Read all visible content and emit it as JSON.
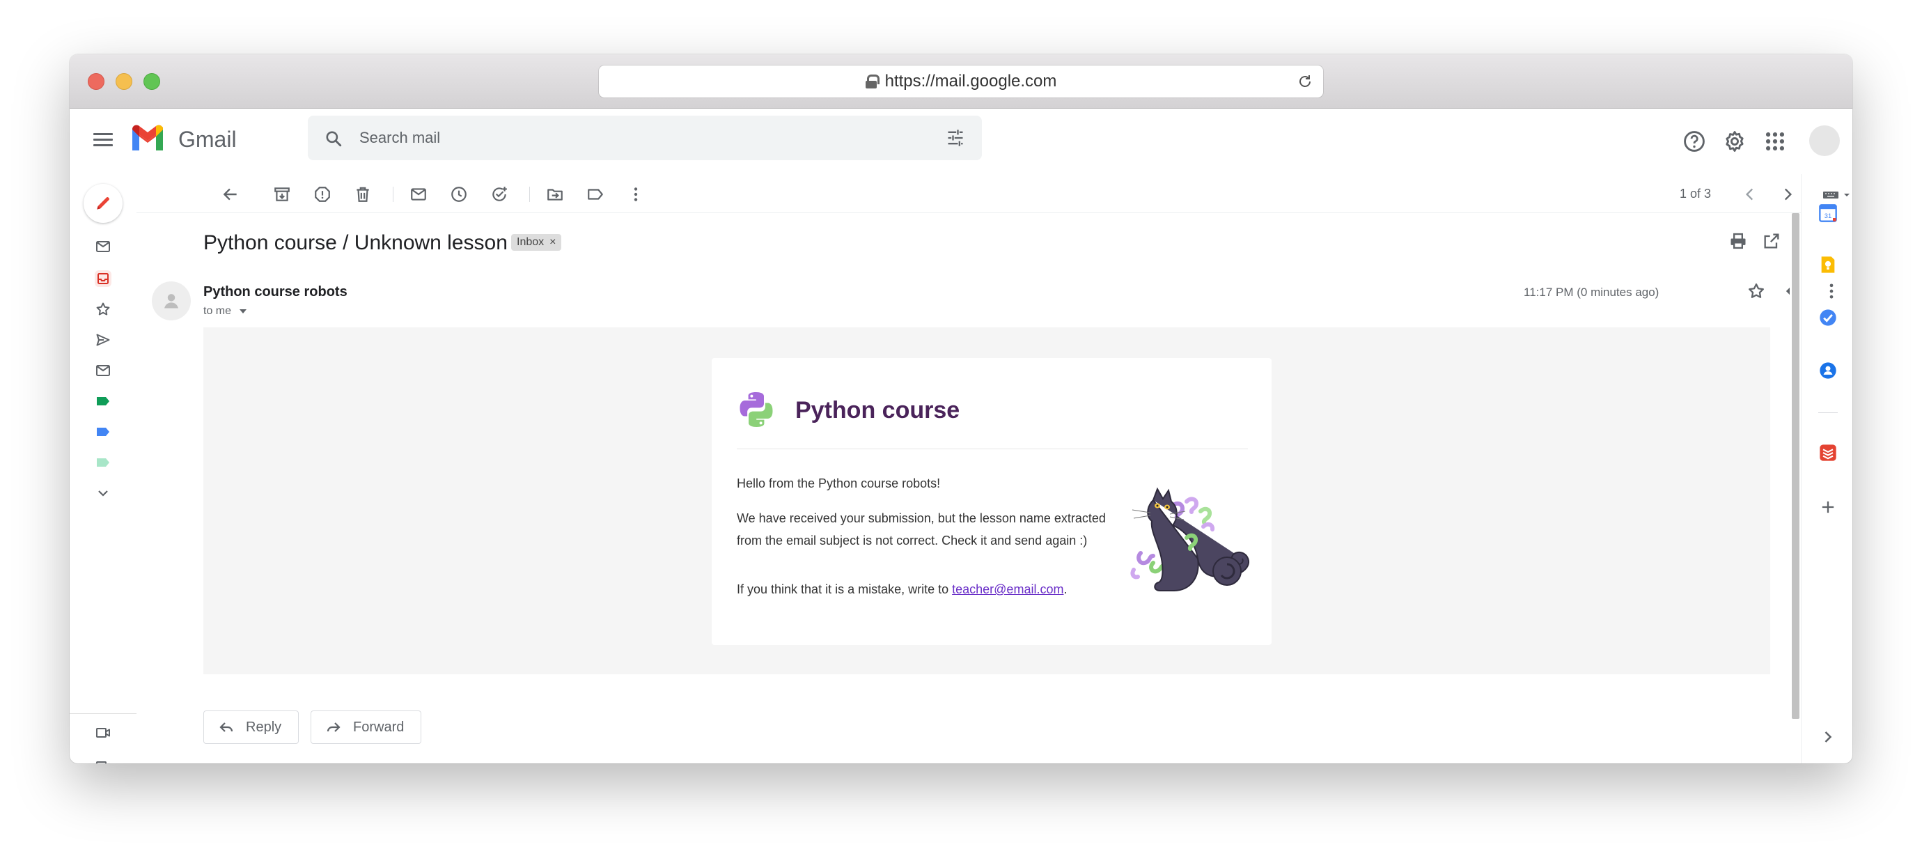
{
  "browser": {
    "url": "https://mail.google.com"
  },
  "gmail": {
    "logo_text": "Gmail",
    "search": {
      "placeholder": "Search mail"
    }
  },
  "toolbar": {
    "pager": "1 of 3"
  },
  "message": {
    "subject": "Python course / Unknown lesson",
    "label_chip": "Inbox",
    "label_chip_close": "×",
    "sender": "Python course robots",
    "recipient": "to me",
    "time": "11:17 PM (0 minutes ago)"
  },
  "email_card": {
    "title": "Python course",
    "greeting": "Hello from the Python course robots!",
    "paragraph": "We have received your submission, but the lesson name extracted from the email subject is not correct. Check it and send again :)",
    "mistake_prefix": "If you think that it is a mistake, write to ",
    "email_link": "teacher@email.com",
    "mistake_suffix": "."
  },
  "actions": {
    "reply": "Reply",
    "forward": "Forward"
  },
  "colors": {
    "gmail_red": "#ea4335",
    "brand_purple": "#4a235a",
    "link_purple": "#6a2fc8",
    "label_green": "#0f9d58",
    "label_blue": "#4285f4",
    "label_mint": "#a8e6c8"
  }
}
